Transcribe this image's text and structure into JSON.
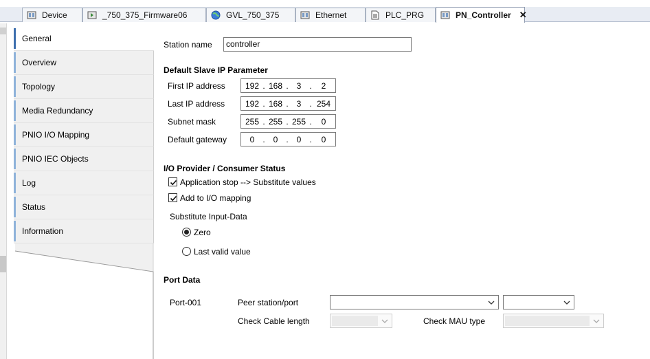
{
  "tabs": [
    {
      "label": "Device",
      "icon": "device-icon"
    },
    {
      "label": "_750_375_Firmware06",
      "icon": "firmware-icon"
    },
    {
      "label": "GVL_750_375",
      "icon": "globe-icon"
    },
    {
      "label": "Ethernet",
      "icon": "device-icon"
    },
    {
      "label": "PLC_PRG",
      "icon": "document-icon"
    },
    {
      "label": "PN_Controller",
      "icon": "device-icon",
      "active": true
    }
  ],
  "side_tabs": [
    {
      "label": "General",
      "active": true
    },
    {
      "label": "Overview"
    },
    {
      "label": "Topology"
    },
    {
      "label": "Media Redundancy"
    },
    {
      "label": "PNIO I/O Mapping"
    },
    {
      "label": "PNIO IEC Objects"
    },
    {
      "label": "Log"
    },
    {
      "label": "Status"
    },
    {
      "label": "Information"
    }
  ],
  "general": {
    "station_name_label": "Station name",
    "station_name_value": "controller",
    "default_slave_header": "Default Slave IP Parameter",
    "ip_rows": [
      {
        "label": "First IP address",
        "octets": [
          "192",
          "168",
          "3",
          "2"
        ]
      },
      {
        "label": "Last IP address",
        "octets": [
          "192",
          "168",
          "3",
          "254"
        ]
      },
      {
        "label": "Subnet mask",
        "octets": [
          "255",
          "255",
          "255",
          "0"
        ]
      },
      {
        "label": "Default gateway",
        "octets": [
          "0",
          "0",
          "0",
          "0"
        ]
      }
    ],
    "io_header": "I/O Provider / Consumer Status",
    "app_stop_label": "Application stop --> Substitute values",
    "app_stop_checked": true,
    "add_io_label": "Add to I/O mapping",
    "add_io_checked": true,
    "substitute_label": "Substitute Input-Data",
    "radio_zero_label": "Zero",
    "radio_last_label": "Last valid value",
    "substitute_selected": "Zero",
    "port_data_header": "Port Data",
    "port_name": "Port-001",
    "peer_label": "Peer station/port",
    "peer_value": "",
    "peer_port_value": "",
    "cable_label": "Check Cable length",
    "cable_value": "",
    "mau_label": "Check MAU type",
    "mau_value": ""
  },
  "colors": {
    "accent_active": "#3d6fae",
    "accent_inactive": "#8fb3da",
    "tab_strip": "#e8ecf3"
  }
}
